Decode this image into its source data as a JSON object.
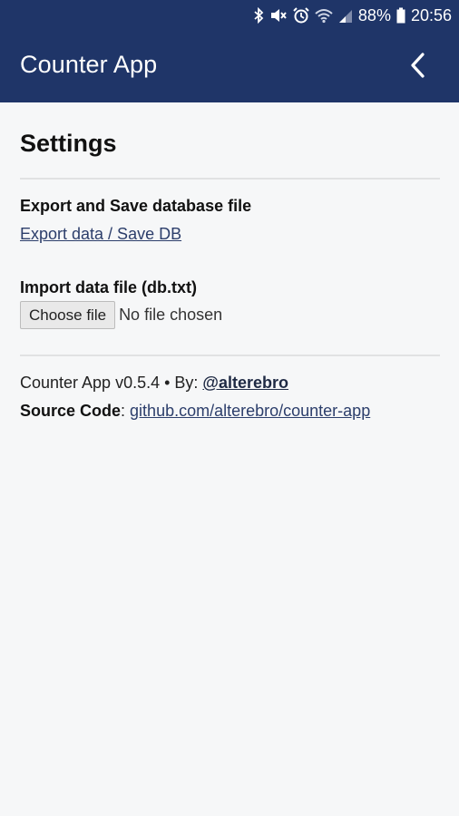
{
  "status": {
    "battery": "88%",
    "time": "20:56"
  },
  "appbar": {
    "title": "Counter App"
  },
  "settings": {
    "heading": "Settings",
    "export_label": "Export and Save database file",
    "export_link": "Export data / Save DB",
    "import_label": "Import data file (db.txt)",
    "choose_button": "Choose file",
    "no_file": "No file chosen"
  },
  "footer": {
    "version_text": "Counter App v0.5.4 • By: ",
    "author": "@alterebro",
    "source_label": "Source Code",
    "source_sep": ": ",
    "source_link": "github.com/alterebro/counter-app"
  },
  "colors": {
    "appbar": "#1f3568",
    "background": "#f6f7f8",
    "link": "#2c3e6b"
  }
}
